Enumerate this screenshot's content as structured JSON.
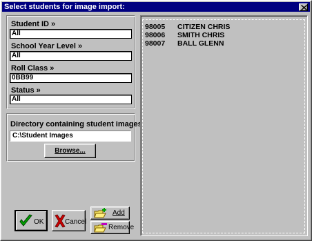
{
  "window": {
    "title": "Select students for image import:"
  },
  "filters": {
    "student_id": {
      "label": "Student ID »",
      "value": "All"
    },
    "school_year_level": {
      "label": "School Year Level »",
      "value": "All"
    },
    "roll_class": {
      "label": "Roll Class »",
      "value": "0BB99"
    },
    "status": {
      "label": "Status »",
      "value": "All"
    }
  },
  "directory": {
    "label": "Directory containing student images",
    "value": "C:\\Student Images",
    "browse_label": "Browse..."
  },
  "buttons": {
    "ok": "OK",
    "cancel": "Cancel",
    "add": "Add",
    "remove": "Remove"
  },
  "students": [
    {
      "id": "98005",
      "name": "CITIZEN CHRIS"
    },
    {
      "id": "98006",
      "name": "SMITH CHRIS"
    },
    {
      "id": "98007",
      "name": "BALL GLENN"
    }
  ]
}
